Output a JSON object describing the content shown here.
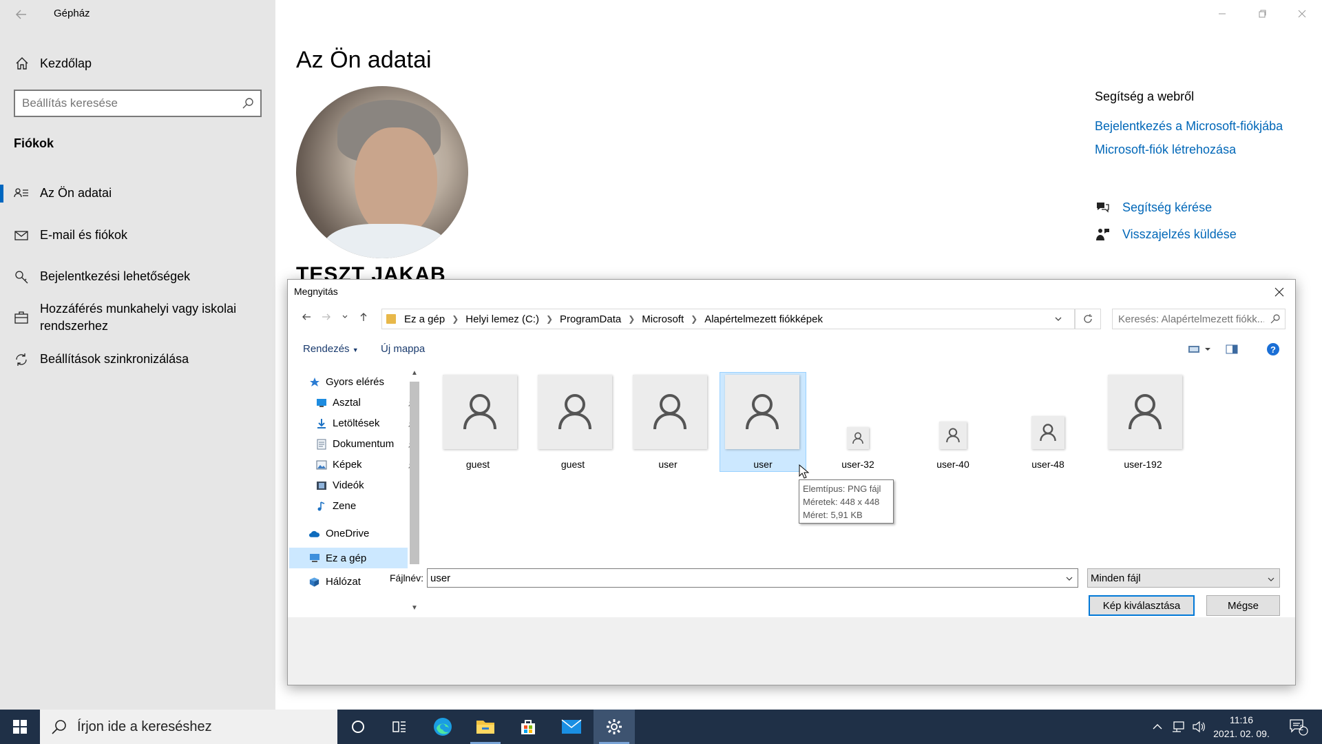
{
  "settings": {
    "app_title": "Gépház",
    "home_label": "Kezdőlap",
    "search_placeholder": "Beállítás keresése",
    "section_title": "Fiókok",
    "nav_items": [
      {
        "label": "Az Ön adatai",
        "icon": "person-list-icon",
        "active": true
      },
      {
        "label": "E-mail és fiókok",
        "icon": "mail-icon",
        "active": false
      },
      {
        "label": "Bejelentkezési lehetőségek",
        "icon": "key-icon",
        "active": false
      },
      {
        "label": "Hozzáférés munkahelyi vagy iskolai rendszerhez",
        "icon": "briefcase-icon",
        "active": false
      },
      {
        "label": "Beállítások szinkronizálása",
        "icon": "sync-icon",
        "active": false
      }
    ],
    "page_title": "Az Ön adatai",
    "user_name": "TESZT JAKAB",
    "help": {
      "title": "Segítség a webről",
      "links": [
        "Bejelentkezés a Microsoft-fiókjába",
        "Microsoft-fiók létrehozása"
      ],
      "get_help": "Segítség kérése",
      "feedback": "Visszajelzés küldése"
    }
  },
  "dialog": {
    "title": "Megnyitás",
    "breadcrumb": [
      "Ez a gép",
      "Helyi lemez (C:)",
      "ProgramData",
      "Microsoft",
      "Alapértelmezett fiókképek"
    ],
    "search_placeholder": "Keresés: Alapértelmezett fiókk...",
    "organize_label": "Rendezés",
    "new_folder_label": "Új mappa",
    "nav_tree": [
      {
        "label": "Gyors elérés",
        "icon": "star-icon",
        "pinned": false
      },
      {
        "label": "Asztal",
        "icon": "desktop-icon",
        "pinned": true
      },
      {
        "label": "Letöltések",
        "icon": "download-icon",
        "pinned": true
      },
      {
        "label": "Dokumentum",
        "icon": "document-icon",
        "pinned": true
      },
      {
        "label": "Képek",
        "icon": "pictures-icon",
        "pinned": true
      },
      {
        "label": "Videók",
        "icon": "videos-icon",
        "pinned": false
      },
      {
        "label": "Zene",
        "icon": "music-icon",
        "pinned": false
      },
      {
        "label": "OneDrive",
        "icon": "cloud-icon",
        "pinned": false
      },
      {
        "label": "Ez a gép",
        "icon": "computer-icon",
        "pinned": false,
        "selected": true
      },
      {
        "label": "Hálózat",
        "icon": "network-icon",
        "pinned": false
      }
    ],
    "files": [
      {
        "name": "guest"
      },
      {
        "name": "guest"
      },
      {
        "name": "user"
      },
      {
        "name": "user",
        "selected": true
      },
      {
        "name": "user-32"
      },
      {
        "name": "user-40"
      },
      {
        "name": "user-48"
      },
      {
        "name": "user-192"
      }
    ],
    "tooltip": {
      "line1": "Elemtípus: PNG fájl",
      "line2": "Méretek: 448 x 448",
      "line3": "Méret: 5,91 KB"
    },
    "filename_label": "Fájlnév:",
    "filename_value": "user",
    "filetype_value": "Minden fájl",
    "ok_label": "Kép kiválasztása",
    "cancel_label": "Mégse"
  },
  "taskbar": {
    "search_placeholder": "Írjon ide a kereséshez",
    "time": "11:16",
    "date": "2021. 02. 09.",
    "notification_count": "2"
  },
  "colors": {
    "accent": "#0067c0",
    "link": "#0067b8",
    "taskbar": "#1f3047",
    "selection": "#cce8ff"
  }
}
